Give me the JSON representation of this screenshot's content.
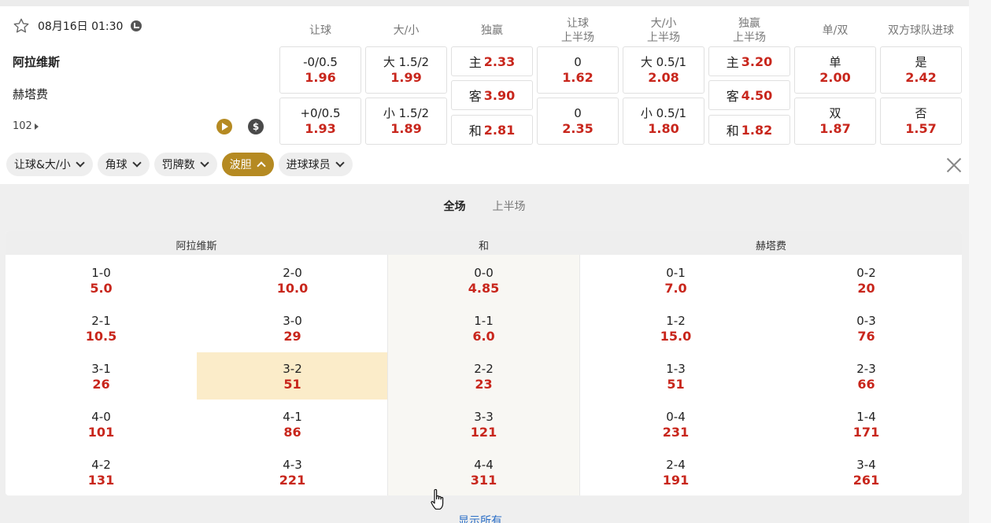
{
  "match": {
    "datetime": "08月16日 01:30",
    "home": "阿拉维斯",
    "away": "赫塔费",
    "more_markets": "102"
  },
  "columns": [
    {
      "line1": "让球",
      "line2": ""
    },
    {
      "line1": "大/小",
      "line2": ""
    },
    {
      "line1": "独赢",
      "line2": ""
    },
    {
      "line1": "让球",
      "line2": "上半场"
    },
    {
      "line1": "大/小",
      "line2": "上半场"
    },
    {
      "line1": "独赢",
      "line2": "上半场"
    },
    {
      "line1": "单/双",
      "line2": ""
    },
    {
      "line1": "双方球队进球",
      "line2": ""
    }
  ],
  "odds": {
    "handicap": [
      {
        "label": "-0/0.5",
        "odd": "1.96"
      },
      {
        "label": "+0/0.5",
        "odd": "1.93"
      }
    ],
    "over_under": [
      {
        "label": "大 1.5/2",
        "odd": "1.99"
      },
      {
        "label": "小 1.5/2",
        "odd": "1.89"
      }
    ],
    "moneyline": [
      {
        "label": "主",
        "odd": "2.33"
      },
      {
        "label": "客",
        "odd": "3.90"
      },
      {
        "label": "和",
        "odd": "2.81"
      }
    ],
    "handicap_1h": [
      {
        "label": "0",
        "odd": "1.62"
      },
      {
        "label": "0",
        "odd": "2.35"
      }
    ],
    "over_under_1h": [
      {
        "label": "大 0.5/1",
        "odd": "2.08"
      },
      {
        "label": "小 0.5/1",
        "odd": "1.80"
      }
    ],
    "moneyline_1h": [
      {
        "label": "主",
        "odd": "3.20"
      },
      {
        "label": "客",
        "odd": "4.50"
      },
      {
        "label": "和",
        "odd": "1.82"
      }
    ],
    "odd_even": [
      {
        "label": "单",
        "odd": "2.00"
      },
      {
        "label": "双",
        "odd": "1.87"
      }
    ],
    "btts": [
      {
        "label": "是",
        "odd": "2.42"
      },
      {
        "label": "否",
        "odd": "1.57"
      }
    ]
  },
  "filters": [
    {
      "label": "让球&大/小",
      "active": false
    },
    {
      "label": "角球",
      "active": false
    },
    {
      "label": "罚牌数",
      "active": false
    },
    {
      "label": "波胆",
      "active": true
    },
    {
      "label": "进球球员",
      "active": false
    }
  ],
  "period_tabs": [
    {
      "label": "全场",
      "active": true
    },
    {
      "label": "上半场",
      "active": false
    }
  ],
  "correct_score": {
    "headers": {
      "home": "阿拉维斯",
      "draw": "和",
      "away": "赫塔费"
    },
    "home_a": [
      {
        "score": "1-0",
        "odd": "5.0"
      },
      {
        "score": "2-1",
        "odd": "10.5"
      },
      {
        "score": "3-1",
        "odd": "26"
      },
      {
        "score": "4-0",
        "odd": "101"
      },
      {
        "score": "4-2",
        "odd": "131"
      }
    ],
    "home_b": [
      {
        "score": "2-0",
        "odd": "10.0"
      },
      {
        "score": "3-0",
        "odd": "29"
      },
      {
        "score": "3-2",
        "odd": "51"
      },
      {
        "score": "4-1",
        "odd": "86"
      },
      {
        "score": "4-3",
        "odd": "221"
      }
    ],
    "draw": [
      {
        "score": "0-0",
        "odd": "4.85"
      },
      {
        "score": "1-1",
        "odd": "6.0"
      },
      {
        "score": "2-2",
        "odd": "23"
      },
      {
        "score": "3-3",
        "odd": "121"
      },
      {
        "score": "4-4",
        "odd": "311"
      }
    ],
    "away_a": [
      {
        "score": "0-1",
        "odd": "7.0"
      },
      {
        "score": "1-2",
        "odd": "15.0"
      },
      {
        "score": "1-3",
        "odd": "51"
      },
      {
        "score": "0-4",
        "odd": "231"
      },
      {
        "score": "2-4",
        "odd": "191"
      }
    ],
    "away_b": [
      {
        "score": "0-2",
        "odd": "20"
      },
      {
        "score": "0-3",
        "odd": "76"
      },
      {
        "score": "2-3",
        "odd": "66"
      },
      {
        "score": "1-4",
        "odd": "171"
      },
      {
        "score": "3-4",
        "odd": "261"
      }
    ],
    "highlight_color": "#fbecc9"
  },
  "show_all": "显示所有",
  "colors": {
    "accent": "#b58a22",
    "odd_red": "#c8261c",
    "link_blue": "#2c6fc7"
  }
}
